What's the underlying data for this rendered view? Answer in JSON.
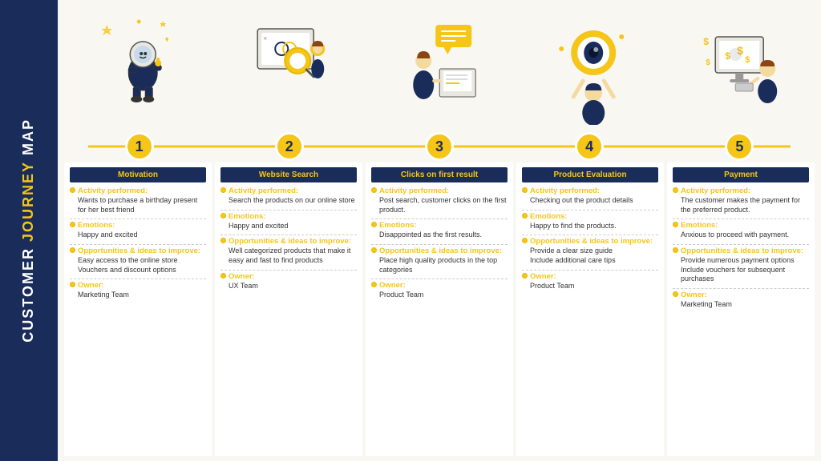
{
  "sidebar": {
    "line1": "CUSTOMER",
    "line2": " JOURNEY",
    "line2_highlight": "JOURNEY",
    "line3": " MAP"
  },
  "steps": [
    {
      "number": "1"
    },
    {
      "number": "2"
    },
    {
      "number": "3"
    },
    {
      "number": "4"
    },
    {
      "number": "5"
    }
  ],
  "cards": [
    {
      "header": "Motivation",
      "activity_title": "Activity performed:",
      "activity_text": "Wants to purchase a birthday present for her best friend",
      "emotions_title": "Emotions:",
      "emotions_text": "Happy and excited",
      "opportunities_title": "Opportunities & ideas to improve:",
      "opportunities_text": "Easy access to the online store\nVouchers and discount options",
      "owner_title": "Owner:",
      "owner_text": "Marketing Team"
    },
    {
      "header": "Website Search",
      "activity_title": "Activity performed:",
      "activity_text": "Search the products on our online store",
      "emotions_title": "Emotions:",
      "emotions_text": "Happy and excited",
      "opportunities_title": "Opportunities & ideas to improve:",
      "opportunities_text": "Well categorized products that make it easy and fast to find products",
      "owner_title": "Owner:",
      "owner_text": "UX Team"
    },
    {
      "header": "Clicks on first result",
      "activity_title": "Activity performed:",
      "activity_text": "Post search, customer clicks on the first product.",
      "emotions_title": "Emotions:",
      "emotions_text": "Disappointed as the first results.",
      "opportunities_title": "Opportunities & ideas to improve:",
      "opportunities_text": "Place high quality products in the top categories",
      "owner_title": "Owner:",
      "owner_text": "Product Team"
    },
    {
      "header": "Product Evaluation",
      "activity_title": "Activity performed:",
      "activity_text": "Checking out the product details",
      "emotions_title": "Emotions:",
      "emotions_text": "Happy to find the products.",
      "opportunities_title": "Opportunities & ideas to improve:",
      "opportunities_text": "Provide a clear size guide\nInclude additional care tips",
      "owner_title": "Owner:",
      "owner_text": "Product Team"
    },
    {
      "header": "Payment",
      "activity_title": "Activity performed:",
      "activity_text": "The customer makes the payment for the preferred product.",
      "emotions_title": "Emotions:",
      "emotions_text": "Anxious to proceed with payment.",
      "opportunities_title": "Opportunities & ideas to improve:",
      "opportunities_text": "Provide numerous payment options\nInclude vouchers for subsequent purchases",
      "owner_title": "Owner:",
      "owner_text": "Marketing Team"
    }
  ]
}
